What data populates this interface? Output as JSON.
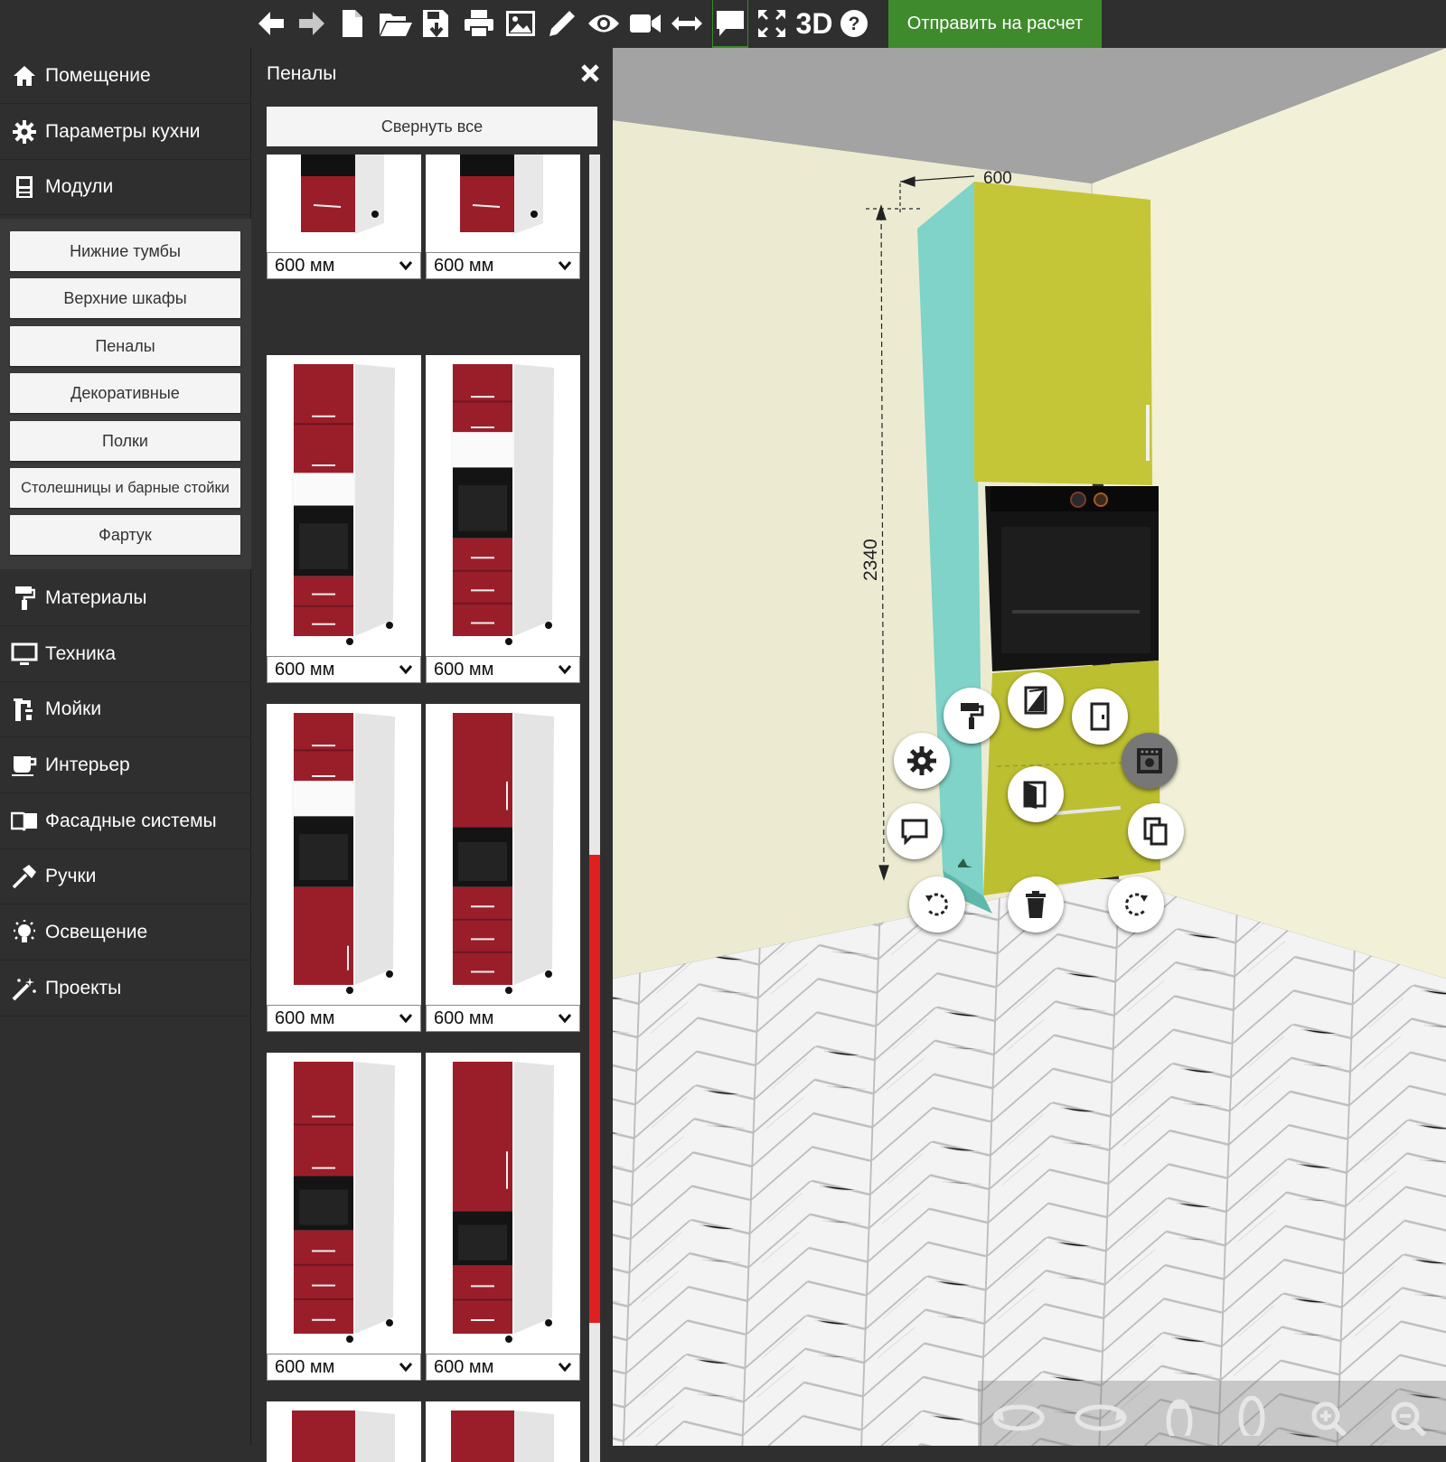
{
  "toolbar": {
    "icons": [
      "arrow-left-icon",
      "arrow-right-icon",
      "new-file-icon",
      "open-folder-icon",
      "save-icon",
      "print-icon",
      "image-icon",
      "pencil-icon",
      "eye-icon",
      "video-camera-icon",
      "resize-arrows-icon",
      "comment-icon",
      "fullscreen-icon",
      "3d-view-icon",
      "help-icon"
    ],
    "label_3d": "3D",
    "send_button": "Отправить на расчет"
  },
  "sidebar": {
    "items": [
      {
        "label": "Помещение",
        "icon": "home-icon"
      },
      {
        "label": "Параметры кухни",
        "icon": "gear-icon"
      },
      {
        "label": "Модули",
        "icon": "cabinet-icon"
      },
      {
        "label": "Материалы",
        "icon": "paint-roller-icon"
      },
      {
        "label": "Техника",
        "icon": "monitor-icon"
      },
      {
        "label": "Мойки",
        "icon": "faucet-icon"
      },
      {
        "label": "Интерьер",
        "icon": "cup-icon"
      },
      {
        "label": "Фасадные системы",
        "icon": "book-icon"
      },
      {
        "label": "Ручки",
        "icon": "hammer-icon"
      },
      {
        "label": "Освещение",
        "icon": "lightbulb-icon"
      },
      {
        "label": "Проекты",
        "icon": "magic-wand-icon"
      }
    ],
    "submenu": [
      "Нижние тумбы",
      "Верхние шкафы",
      "Пеналы",
      "Декоративные",
      "Полки",
      "Столешницы и барные стойки",
      "Фартук"
    ]
  },
  "panel": {
    "title": "Пеналы",
    "collapse_button": "Свернуть все",
    "size_option": "600 мм",
    "cards": [
      {
        "variant": "partial-top",
        "size": "600 мм"
      },
      {
        "variant": "partial-top",
        "size": "600 мм"
      },
      {
        "variant": "two-top-oven-two-drawers",
        "size": "600 мм"
      },
      {
        "variant": "one-top-oven-three-drawers",
        "size": "600 мм"
      },
      {
        "variant": "one-top-oven-door",
        "size": "600 мм"
      },
      {
        "variant": "tall-door-oven-three-drawers",
        "size": "600 мм"
      },
      {
        "variant": "two-top-oven-three-drawers",
        "size": "600 мм"
      },
      {
        "variant": "tall-door-oven-two-drawers",
        "size": "600 мм"
      }
    ]
  },
  "viewport": {
    "dimension_width": "600",
    "dimension_height": "2340",
    "object_controls": [
      "paint-roller-icon",
      "facade-toggle-icon",
      "door-icon",
      "oven-icon",
      "gear-icon",
      "open-door-icon",
      "comment-icon",
      "copy-icon",
      "rotate-left-icon",
      "trash-icon",
      "rotate-right-icon"
    ],
    "nav_controls": [
      "orbit-left-icon",
      "orbit-right-icon",
      "tilt-up-icon",
      "tilt-down-icon",
      "zoom-in-icon",
      "zoom-out-icon"
    ]
  },
  "colors": {
    "accent_green": "#3f8a2c",
    "cabinet_front": "#c4c637",
    "cabinet_side": "#7fd3c9",
    "catalog_red": "#9a1e2a",
    "scrollbar": "#e02020"
  }
}
